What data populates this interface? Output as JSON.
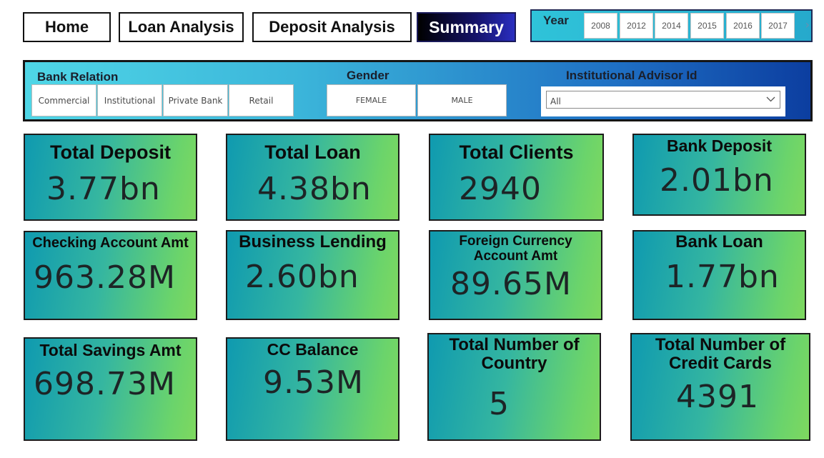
{
  "nav": {
    "home": "Home",
    "loan_analysis": "Loan Analysis",
    "deposit_analysis": "Deposit Analysis",
    "summary": "Summary"
  },
  "year_slicer": {
    "title": "Year",
    "years": [
      "2008",
      "2012",
      "2014",
      "2015",
      "2016",
      "2017"
    ],
    "more_icon": "chevron-right-icon"
  },
  "filters": {
    "bank_relation": {
      "label": "Bank Relation",
      "options": [
        "Commercial",
        "Institutional",
        "Private Bank",
        "Retail"
      ]
    },
    "gender": {
      "label": "Gender",
      "options": [
        "FEMALE",
        "MALE"
      ]
    },
    "advisor": {
      "label": "Institutional Advisor Id",
      "selected": "All"
    }
  },
  "kpis": {
    "total_deposit": {
      "title": "Total Deposit",
      "value": "3.77bn"
    },
    "total_loan": {
      "title": "Total Loan",
      "value": "4.38bn"
    },
    "total_clients": {
      "title": "Total Clients",
      "value": "2940"
    },
    "bank_deposit": {
      "title": "Bank Deposit",
      "value": "2.01bn"
    },
    "checking_account_amt": {
      "title": "Checking Account Amt",
      "value": "963.28M"
    },
    "business_lending": {
      "title": "Business Lending",
      "value": "2.60bn"
    },
    "foreign_currency_account_amt": {
      "title": "Foreign Currency Account Amt",
      "value": "89.65M"
    },
    "bank_loan": {
      "title": "Bank Loan",
      "value": "1.77bn"
    },
    "total_savings_amt": {
      "title": "Total Savings Amt",
      "value": "698.73M"
    },
    "cc_balance": {
      "title": "CC Balance",
      "value": "9.53M"
    },
    "total_number_of_country": {
      "title": "Total Number of Country",
      "value": "5"
    },
    "total_number_of_credit_cards": {
      "title": "Total Number of Credit Cards",
      "value": "4391"
    }
  },
  "colors": {
    "card_gradient_start": "#0f9ab0",
    "card_gradient_end": "#7ed85f",
    "filter_gradient_start": "#4fd6e6",
    "filter_gradient_end": "#0c3ea0",
    "active_nav": "#14126a"
  }
}
